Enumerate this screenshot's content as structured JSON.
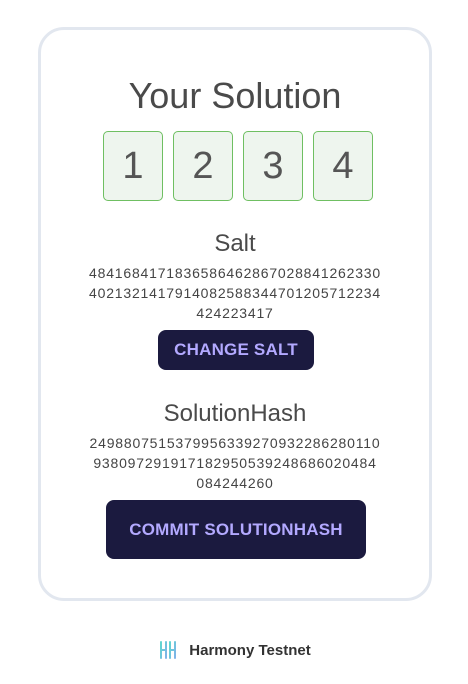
{
  "solution": {
    "title": "Your Solution",
    "digits": [
      "1",
      "2",
      "3",
      "4"
    ]
  },
  "salt": {
    "label": "Salt",
    "value": "484168417183658646286702884126233040213214179140825883447012057122344 24223417",
    "line1": "484168417183658646286702884126233 0",
    "button": "CHANGE SALT"
  },
  "hash": {
    "label": "SolutionHash",
    "button": "COMMIT SOLUTIONHASH"
  },
  "footer": {
    "network": "Harmony Testnet"
  },
  "colors": {
    "accent_bg": "#1b1a3f",
    "accent_text": "#b3a9ff",
    "digit_border": "#6fbf62",
    "digit_bg": "#eef5ee"
  }
}
